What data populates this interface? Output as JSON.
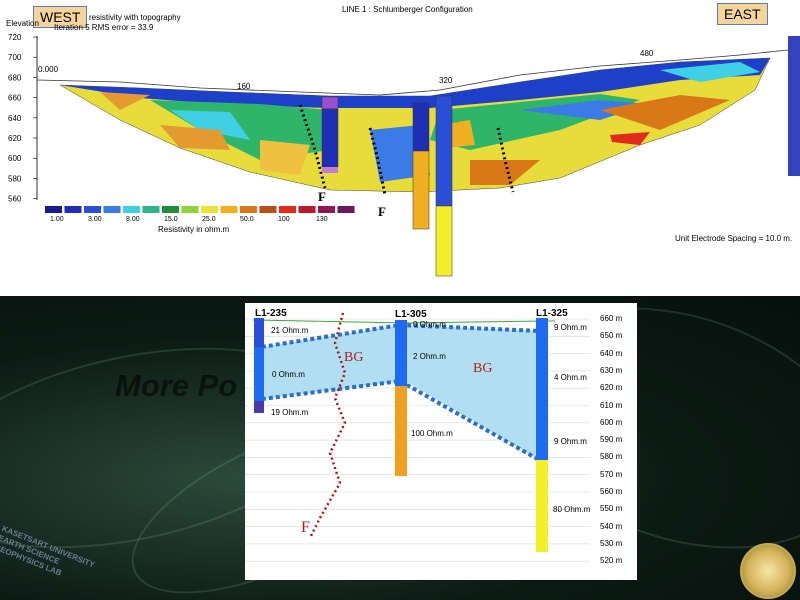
{
  "top_section": {
    "west_label": "WEST",
    "east_label": "EAST",
    "title": "LINE 1 : Schlumberger Configuration",
    "subtitle_line1": "resistivity with topography",
    "subtitle_line2": "Iteration 5 RMS error = 33.9",
    "elevation_label": "Elevation",
    "y_ticks": [
      "720",
      "700",
      "680",
      "660",
      "640",
      "620",
      "600",
      "580",
      "560"
    ],
    "distance_labels": [
      "0.000",
      "160",
      "320",
      "480"
    ],
    "fault_markers": [
      "F",
      "F"
    ],
    "legend_values": [
      "1.00",
      "3.00",
      "8.00",
      "15.0",
      "25.0",
      "50.0",
      "100",
      "130"
    ],
    "legend_colors": [
      "#1a1a8c",
      "#1f2fb5",
      "#2a4fd6",
      "#3a7be6",
      "#3fd0e6",
      "#2fb58c",
      "#1f8f3a",
      "#8fd23a",
      "#e8e23a",
      "#f0b020",
      "#d87818",
      "#b8501a",
      "#e02a1a",
      "#b81a2a",
      "#8c1a4a",
      "#6a1a5a"
    ],
    "legend_caption": "Resistivity in ohm.m",
    "electrode_spacing": "Unit Electrode Spacing = 10.0 m."
  },
  "bottom_section": {
    "background_text": "More Po                                    Area",
    "university_text": [
      "KASETSART UNIVERSITY",
      "EARTH SCIENCE",
      "GEOPHYSICS LAB"
    ],
    "borehole_labels": [
      "L1-235",
      "L1-305",
      "L1-325"
    ],
    "resistivity_annotations": [
      "21 Ohm.m",
      "0 Ohm.m",
      "19 Ohm.m",
      "0 Ohm.m",
      "2 Ohm.m",
      "100 Ohm.m",
      "9 Ohm.m",
      "4 Ohm.m",
      "9 Ohm.m",
      "80 Ohm.m"
    ],
    "zone_labels": [
      "BG",
      "BG"
    ],
    "fault_label": "F",
    "elevation_ticks": [
      "660 m",
      "650 m",
      "640 m",
      "630 m",
      "620 m",
      "610 m",
      "600 m",
      "590 m",
      "580 m",
      "570 m",
      "560 m",
      "550 m",
      "540 m",
      "530 m",
      "520 m"
    ]
  }
}
